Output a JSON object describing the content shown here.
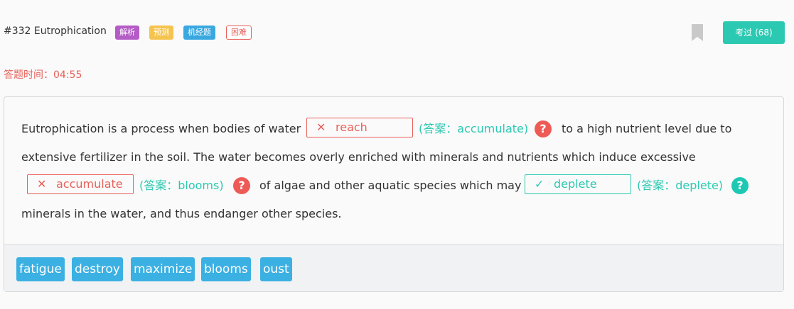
{
  "header": {
    "title": "#332 Eutrophication",
    "tags": [
      "解析",
      "预测",
      "机经题",
      "困难"
    ],
    "bookmark_icon": "bookmark-icon",
    "exam_button": "考过 (68)"
  },
  "timer": {
    "label": "答题时间：04:55"
  },
  "passage": {
    "line1_pre": "Eutrophication is a process when bodies of water",
    "blank1": {
      "mark": "✕",
      "value": "reach",
      "answer": "(答案：accumulate)",
      "help": "?"
    },
    "line1_post": "to a high nutrient level due to",
    "line2": "extensive fertilizer in the soil. The water becomes overly enriched with minerals and nutrients which induce excessive",
    "blank2": {
      "mark": "✕",
      "value": "accumulate",
      "answer": "(答案：blooms)",
      "help": "?"
    },
    "line3_mid": "of algae and other aquatic species which may",
    "blank3": {
      "mark": "✓",
      "value": "deplete",
      "answer": "(答案：deplete)",
      "help": "?"
    },
    "line4": "minerals in the water, and thus endanger other species."
  },
  "options": [
    "fatigue",
    "destroy",
    "maximize",
    "blooms",
    "oust"
  ],
  "colors": {
    "accent": "#2cc9b2",
    "wrong": "#e8605a",
    "option": "#3bb0e2"
  }
}
